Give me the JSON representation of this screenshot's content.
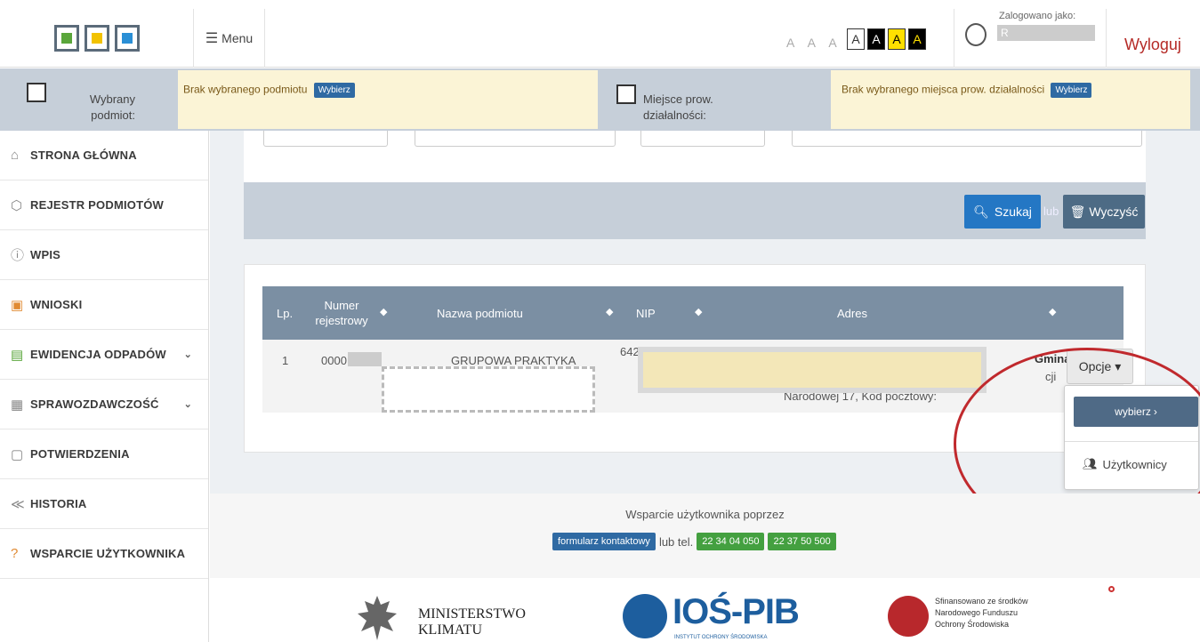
{
  "header": {
    "menu_label": "Menu",
    "font_size_letters": "A A A",
    "contrast_options": [
      "A",
      "A",
      "A",
      "A"
    ],
    "logged_in_label": "Zalogowano jako:",
    "logged_in_value": "R",
    "logout_label": "Wyloguj"
  },
  "subject_bar": {
    "subject_label": "Wybrany podmiot:",
    "subject_status": "Brak wybranego podmiotu",
    "subject_button": "Wybierz",
    "place_label": "Miejsce prow. działalności:",
    "place_status": "Brak wybranego miejsca prow. działalności",
    "place_button": "Wybierz"
  },
  "sidebar": {
    "items": [
      {
        "label": "STRONA GŁÓWNA",
        "icon": "home-icon"
      },
      {
        "label": "REJESTR PODMIOTÓW",
        "icon": "cube-icon"
      },
      {
        "label": "WPIS",
        "icon": "info-icon"
      },
      {
        "label": "WNIOSKI",
        "icon": "calendar-icon"
      },
      {
        "label": "EWIDENCJA ODPADÓW",
        "icon": "list-icon",
        "has_submenu": true
      },
      {
        "label": "SPRAWOZDAWCZOŚĆ",
        "icon": "clipboard-icon",
        "has_submenu": true
      },
      {
        "label": "POTWIERDZENIA",
        "icon": "square-icon"
      },
      {
        "label": "HISTORIA",
        "icon": "rewind-icon"
      },
      {
        "label": "WSPARCIE UŻYTKOWNIKA",
        "icon": "help-icon"
      }
    ]
  },
  "search": {
    "search_button": "Szukaj",
    "or_label": "lub",
    "clear_button": "Wyczyść"
  },
  "table": {
    "columns": [
      "Lp.",
      "Numer rejestrowy",
      "Nazwa podmiotu",
      "NIP",
      "Adres"
    ],
    "rows": [
      {
        "lp": "1",
        "numer": "0000",
        "nazwa": "GRUPOWA PRAKTYKA",
        "nip": "6422",
        "adres_fragment": "Narodowej 17, Kod pocztowy:",
        "gmina_label": "Gmina:",
        "gmina_fragment": "cji"
      }
    ],
    "options_button": "Opcje"
  },
  "dropdown": {
    "select_label": "wybierz",
    "users_label": "Użytkownicy"
  },
  "support": {
    "title": "Wsparcie użytkownika poprzez",
    "form_button": "formularz kontaktowy",
    "phone_label": "lub tel.",
    "phone1": "22 34 04 050",
    "phone2": "22 37 50 500"
  },
  "footer": {
    "ministry_line1": "MINISTERSTWO",
    "ministry_line2": "KLIMATU",
    "ios_name": "IOŚ-PIB",
    "ios_sub": "INSTYTUT OCHRONY ŚRODOWISKA",
    "nfos_line1": "Sfinansowano ze środków",
    "nfos_line2": "Narodowego Funduszu",
    "nfos_line3": "Ochrony Środowiska"
  },
  "colors": {
    "accent_blue": "#2477c4",
    "table_header": "#7b8fa3",
    "subject_bar": "#c6cfd9",
    "highlight_yellow": "#fbf4d6",
    "logout_red": "#b52b27",
    "support_green": "#44a040"
  }
}
